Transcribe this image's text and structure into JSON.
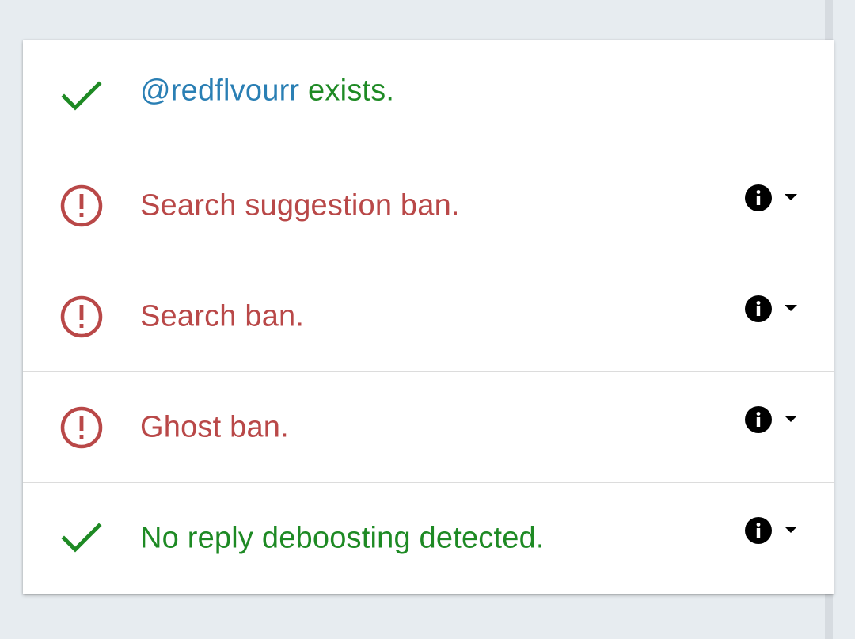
{
  "colors": {
    "ok": "#1e8a24",
    "bad": "#b94848",
    "handle": "#2a7fb4"
  },
  "rows": [
    {
      "status": "ok",
      "icon": "check-icon",
      "handle": "@redflvourr",
      "text": " exists.",
      "has_controls": false
    },
    {
      "status": "bad",
      "icon": "alert-circle-icon",
      "text": "Search suggestion ban.",
      "has_controls": true
    },
    {
      "status": "bad",
      "icon": "alert-circle-icon",
      "text": "Search ban.",
      "has_controls": true
    },
    {
      "status": "bad",
      "icon": "alert-circle-icon",
      "text": "Ghost ban.",
      "has_controls": true
    },
    {
      "status": "ok",
      "icon": "check-icon",
      "text": "No reply deboosting detected.",
      "has_controls": true
    }
  ],
  "controls": {
    "info_icon": "info-icon",
    "expand_icon": "caret-down-icon"
  }
}
